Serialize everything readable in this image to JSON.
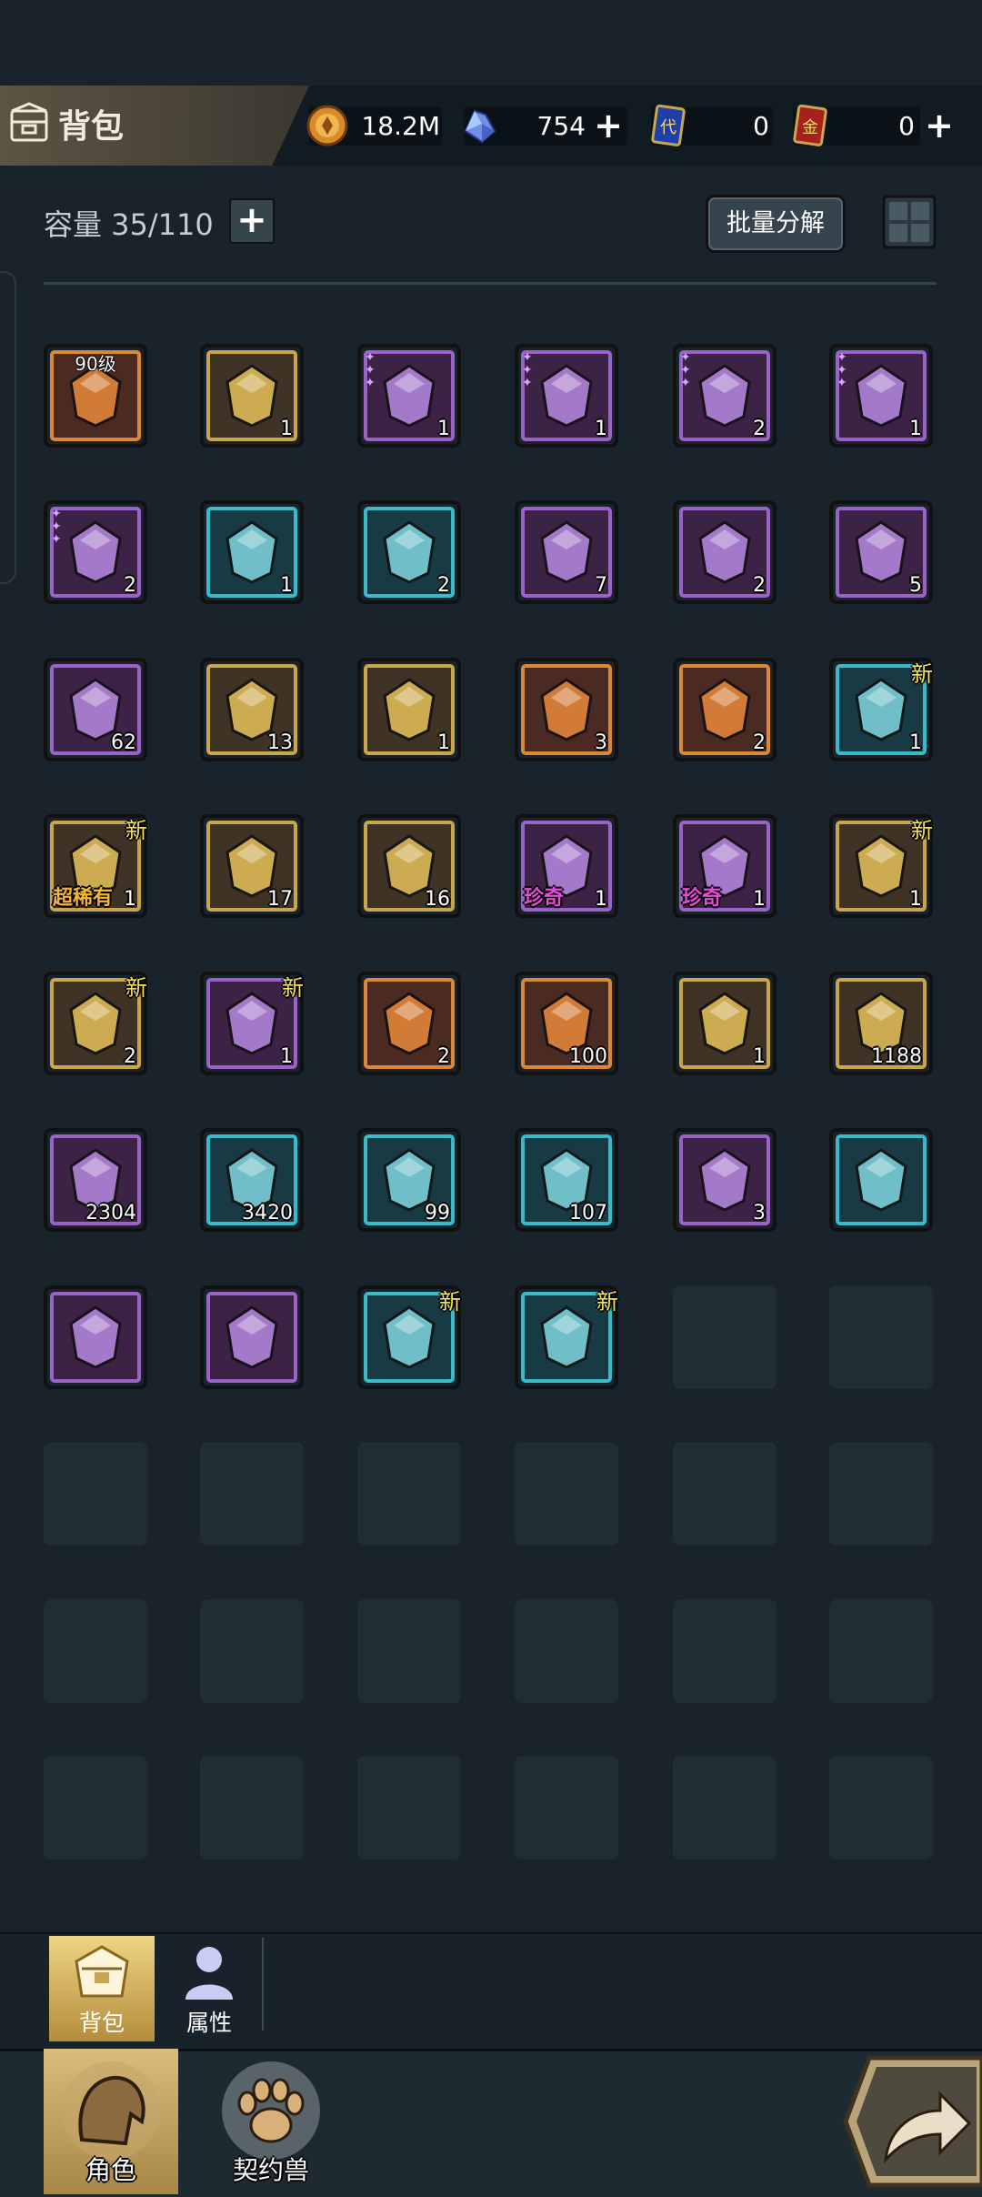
{
  "header": {
    "title": "背包",
    "resources": [
      {
        "name": "coin",
        "icon": "coin-icon",
        "value": "18.2M",
        "has_plus": false
      },
      {
        "name": "crystal",
        "icon": "crystal-icon",
        "value": "754",
        "has_plus": true
      },
      {
        "name": "blue-card",
        "icon": "blue-card-icon",
        "card_text": "代",
        "value": "0",
        "has_plus": false
      },
      {
        "name": "red-card",
        "icon": "red-card-icon",
        "card_text": "金",
        "value": "0",
        "has_plus": true
      }
    ]
  },
  "toolbar": {
    "capacity_label": "容量 35/110",
    "add_symbol": "+",
    "batch_decompose_label": "批量分解"
  },
  "items": [
    {
      "id": "level-chest",
      "rarity": "orange",
      "level": "90级",
      "count": "",
      "new": false
    },
    {
      "id": "spell-book",
      "rarity": "gold",
      "count": "1",
      "new": false
    },
    {
      "id": "claw-gauntlet-a",
      "rarity": "purple",
      "count": "1",
      "stars": 3,
      "new": false
    },
    {
      "id": "claw-gauntlet-b",
      "rarity": "purple",
      "count": "1",
      "stars": 3,
      "new": false
    },
    {
      "id": "shoulder-armor",
      "rarity": "purple",
      "count": "2",
      "stars": 3,
      "new": false
    },
    {
      "id": "iron-ring",
      "rarity": "purple",
      "count": "1",
      "stars": 3,
      "new": false
    },
    {
      "id": "amulet-necklace",
      "rarity": "purple",
      "count": "2",
      "stars": 3,
      "new": false
    },
    {
      "id": "red-ore",
      "rarity": "cyan",
      "count": "1",
      "new": false
    },
    {
      "id": "green-herb",
      "rarity": "cyan",
      "count": "2",
      "new": false
    },
    {
      "id": "jeweled-egg",
      "rarity": "purple",
      "count": "7",
      "new": false
    },
    {
      "id": "mana-potion-bottle",
      "rarity": "purple",
      "count": "2",
      "new": false
    },
    {
      "id": "bread-loaf",
      "rarity": "purple",
      "count": "5",
      "new": false
    },
    {
      "id": "roast-ham",
      "rarity": "purple",
      "count": "62",
      "new": false
    },
    {
      "id": "red-potion-a",
      "rarity": "gold",
      "count": "13",
      "new": false
    },
    {
      "id": "red-potion-b",
      "rarity": "gold",
      "count": "1",
      "new": false
    },
    {
      "id": "lavender-herb",
      "rarity": "orange",
      "count": "3",
      "new": false
    },
    {
      "id": "blue-herb",
      "rarity": "orange",
      "count": "2",
      "new": false
    },
    {
      "id": "gift-box",
      "rarity": "cyan",
      "count": "1",
      "new": true
    },
    {
      "id": "tornado-rare",
      "rarity": "gold",
      "count": "1",
      "tag": "超稀有",
      "tag_color": "gold",
      "new": true
    },
    {
      "id": "stone-egg-a",
      "rarity": "gold",
      "count": "17",
      "new": false
    },
    {
      "id": "tornado-common",
      "rarity": "gold",
      "count": "16",
      "new": false
    },
    {
      "id": "stone-egg-b",
      "rarity": "purple",
      "count": "1",
      "tag": "珍奇",
      "tag_color": "mag",
      "new": false
    },
    {
      "id": "tornado-precious",
      "rarity": "purple",
      "count": "1",
      "tag": "珍奇",
      "tag_color": "mag",
      "new": false
    },
    {
      "id": "golden-vase",
      "rarity": "gold",
      "count": "1",
      "new": true
    },
    {
      "id": "purple-vase",
      "rarity": "gold",
      "count": "2",
      "new": true
    },
    {
      "id": "blue-vase",
      "rarity": "purple",
      "count": "1",
      "new": true
    },
    {
      "id": "angel-medal",
      "rarity": "orange",
      "count": "2",
      "new": false
    },
    {
      "id": "fire-crystal",
      "rarity": "orange",
      "count": "100",
      "new": false
    },
    {
      "id": "moon-bomb",
      "rarity": "gold",
      "count": "1",
      "new": false
    },
    {
      "id": "gold-star-shard",
      "rarity": "gold",
      "count": "1188",
      "new": false
    },
    {
      "id": "purple-shard",
      "rarity": "purple",
      "count": "2304",
      "new": false
    },
    {
      "id": "ice-crystal",
      "rarity": "cyan",
      "count": "3420",
      "new": false
    },
    {
      "id": "lava-rock",
      "rarity": "cyan",
      "count": "99",
      "new": false
    },
    {
      "id": "dark-ore-star",
      "rarity": "cyan",
      "count": "107",
      "new": false
    },
    {
      "id": "fire-cauldron",
      "rarity": "purple",
      "count": "3",
      "new": false
    },
    {
      "id": "blue-swirl-rune",
      "rarity": "cyan",
      "count": "",
      "new": false
    },
    {
      "id": "clover-rune",
      "rarity": "purple",
      "count": "",
      "new": false
    },
    {
      "id": "flame-rune",
      "rarity": "purple",
      "count": "",
      "new": false
    },
    {
      "id": "swirl-rune-a",
      "rarity": "cyan",
      "count": "",
      "new": true
    },
    {
      "id": "swirl-rune-b",
      "rarity": "cyan",
      "count": "",
      "new": true
    }
  ],
  "new_label": "新",
  "empty_slots": 20,
  "subnav": {
    "bag_label": "背包",
    "attributes_label": "属性"
  },
  "bottomnav": {
    "character_label": "角色",
    "pet_label": "契约兽"
  },
  "colors": {
    "orange": "#d9883a",
    "gold": "#c9a64d",
    "purple": "#9a63c8",
    "cyan": "#3ab9c8",
    "accent": "#d8bd7c"
  }
}
